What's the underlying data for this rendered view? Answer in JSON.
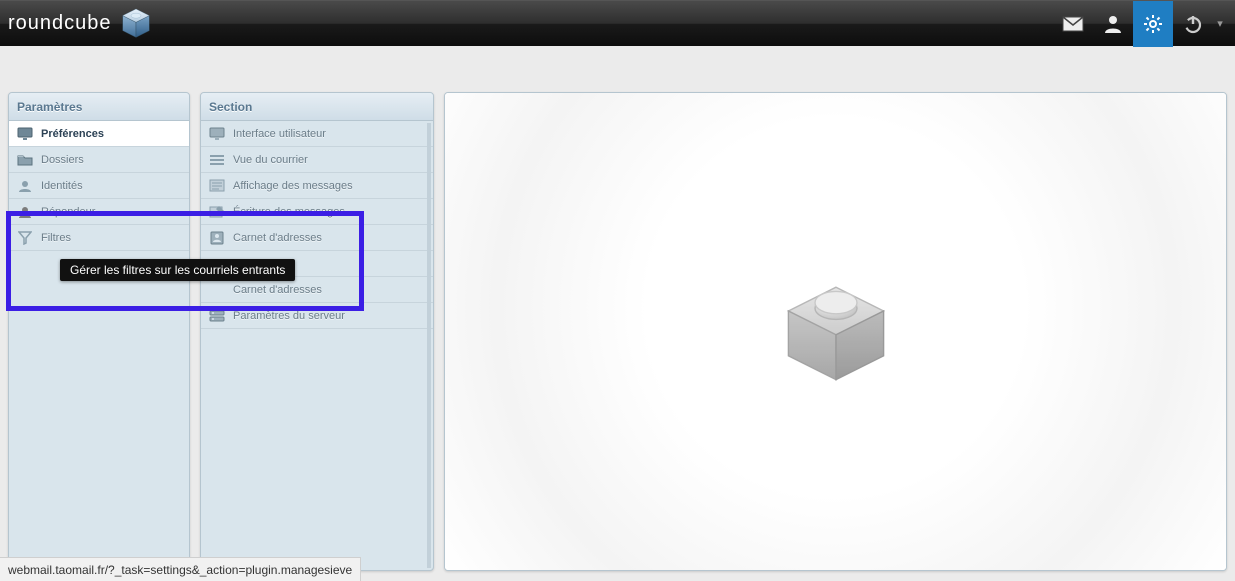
{
  "app": {
    "name": "roundcube"
  },
  "topnav": [
    {
      "name": "mail",
      "icon": "mail-icon",
      "active": false
    },
    {
      "name": "contacts",
      "icon": "person-icon",
      "active": false
    },
    {
      "name": "settings",
      "icon": "gear-icon",
      "active": true
    },
    {
      "name": "logout",
      "icon": "power-icon",
      "active": false
    }
  ],
  "settings_panel": {
    "title": "Paramètres",
    "items": [
      {
        "label": "Préférences",
        "icon": "monitor-icon",
        "active": true
      },
      {
        "label": "Dossiers",
        "icon": "folder-icon",
        "active": false
      },
      {
        "label": "Identités",
        "icon": "identity-icon",
        "active": false
      },
      {
        "label": "Répondeur",
        "icon": "away-icon",
        "active": false
      },
      {
        "label": "Filtres",
        "icon": "filter-icon",
        "active": false
      }
    ]
  },
  "section_panel": {
    "title": "Section",
    "items": [
      {
        "label": "Interface utilisateur",
        "icon": "monitor-icon"
      },
      {
        "label": "Vue du courrier",
        "icon": "list-icon"
      },
      {
        "label": "Affichage des messages",
        "icon": "message-view-icon"
      },
      {
        "label": "Écriture des messages",
        "icon": "compose-icon"
      },
      {
        "label": "Carnet d'adresses",
        "icon": "addressbook-icon"
      },
      {
        "label": "",
        "icon": "blank-icon"
      },
      {
        "label": "Carnet d'adresses",
        "icon": "blank-icon"
      },
      {
        "label": "Paramètres du serveur",
        "icon": "server-icon"
      }
    ]
  },
  "tooltip": "Gérer les filtres sur les courriels entrants",
  "status_url": "webmail.taomail.fr/?_task=settings&_action=plugin.managesieve"
}
